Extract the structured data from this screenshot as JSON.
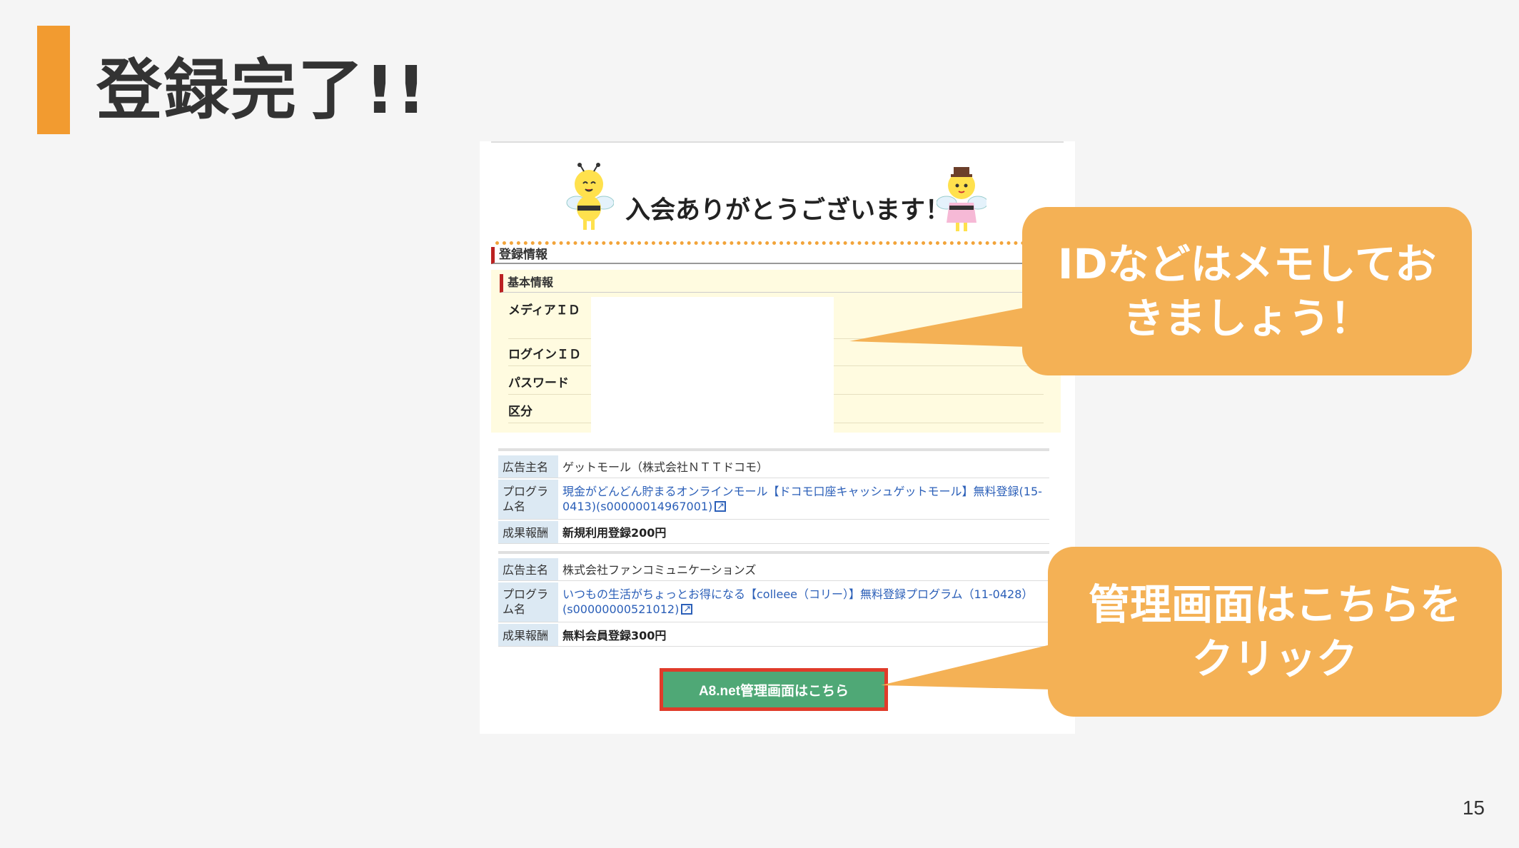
{
  "slide": {
    "title": "登録完了!!",
    "page_number": "15"
  },
  "screen": {
    "welcome_text": "入会ありがとうございます！",
    "section_title": "登録情報",
    "basic_title": "基本情報",
    "basic_rows": [
      "メディアＩＤ",
      "ログインＩＤ",
      "パスワード",
      "区分"
    ],
    "ads": [
      {
        "rows": [
          {
            "label": "広告主名",
            "value": "ゲットモール（株式会社ＮＴＴドコモ）",
            "style": "normal"
          },
          {
            "label": "プログラム名",
            "value": "現金がどんどん貯まるオンラインモール【ドコモ口座キャッシュゲットモール】無料登録(15-0413)(s00000014967001)",
            "style": "link"
          },
          {
            "label": "成果報酬",
            "value": "新規利用登録200円",
            "style": "bold"
          }
        ]
      },
      {
        "rows": [
          {
            "label": "広告主名",
            "value": "株式会社ファンコミュニケーションズ",
            "style": "normal"
          },
          {
            "label": "プログラム名",
            "value": "いつもの生活がちょっとお得になる【colleee（コリー）】無料登録プログラム（11-0428）(s00000000521012)",
            "style": "link"
          },
          {
            "label": "成果報酬",
            "value": "無料会員登録300円",
            "style": "bold"
          }
        ]
      }
    ],
    "admin_button_label": "A8.net管理画面はこちら"
  },
  "callouts": {
    "memo_line1": "IDなどはメモしてお",
    "memo_line2": "きましょう！",
    "click_line1": "管理画面はこちらを",
    "click_line2": "クリック"
  },
  "colors": {
    "accent": "#f29b30",
    "callout": "#f4b155",
    "button": "#4fa876",
    "button_border": "#e03b2a"
  }
}
